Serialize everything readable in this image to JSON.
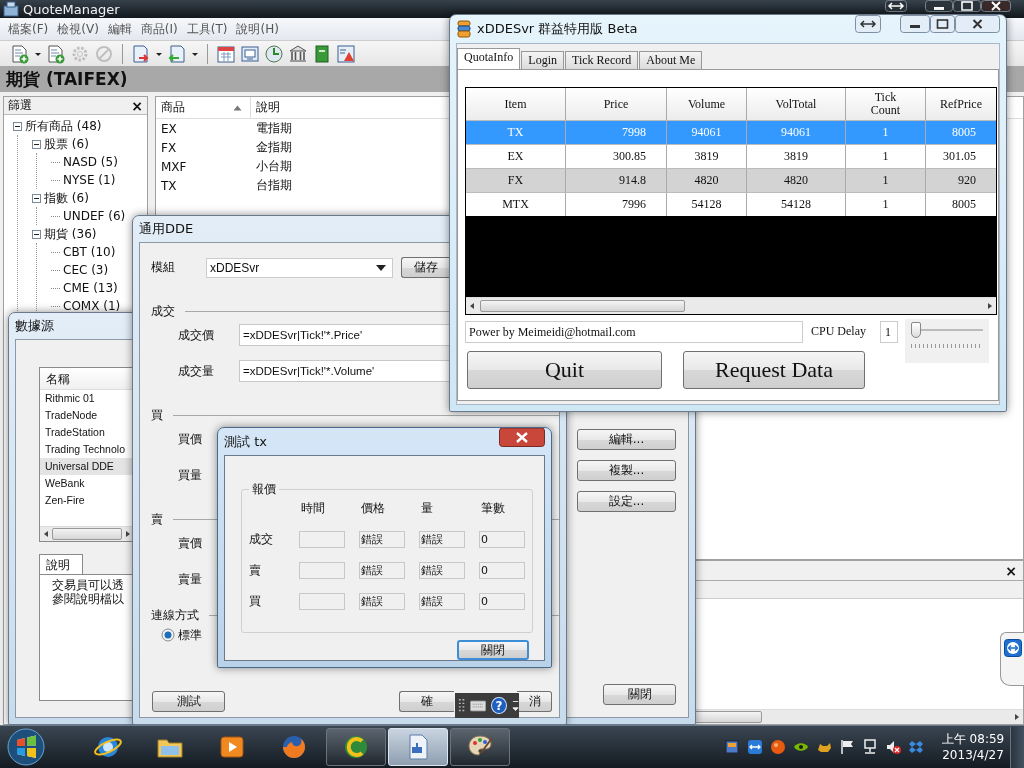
{
  "main_window": {
    "title": "QuoteManager",
    "menu": [
      "檔案(F)",
      "檢視(V)",
      "編輯",
      "商品(I)",
      "工具(T)",
      "說明(H)"
    ],
    "toolbar_groups": [
      [
        {
          "kind": "sheet-add",
          "disabled": false
        },
        {
          "kind": "caret",
          "disabled": false
        },
        {
          "kind": "sheet-add",
          "disabled": false
        },
        {
          "kind": "gear",
          "disabled": true
        },
        {
          "kind": "stop",
          "disabled": true
        }
      ],
      [
        {
          "kind": "export",
          "disabled": false
        },
        {
          "kind": "caret",
          "disabled": false
        },
        {
          "kind": "import",
          "disabled": false
        },
        {
          "kind": "caret",
          "disabled": false
        }
      ],
      [
        {
          "kind": "calendar",
          "disabled": false
        },
        {
          "kind": "monitor",
          "disabled": false
        },
        {
          "kind": "clock",
          "disabled": false
        },
        {
          "kind": "bank",
          "disabled": false
        },
        {
          "kind": "book",
          "disabled": false
        },
        {
          "kind": "chart",
          "disabled": false
        }
      ]
    ],
    "header": "期貨 (TAIFEX)",
    "filter_panel": {
      "title": "篩選",
      "close": "×",
      "tree": [
        {
          "label": "所有商品 (48)",
          "expanded": true,
          "children": [
            {
              "label": "股票 (6)",
              "expanded": true,
              "children": [
                {
                  "label": "NASD (5)"
                },
                {
                  "label": "NYSE (1)"
                }
              ]
            },
            {
              "label": "指數 (6)",
              "expanded": true,
              "children": [
                {
                  "label": "UNDEF (6)"
                }
              ]
            },
            {
              "label": "期貨 (36)",
              "expanded": true,
              "children": [
                {
                  "label": "CBT (10)"
                },
                {
                  "label": "CEC (3)"
                },
                {
                  "label": "CME (13)"
                },
                {
                  "label": "COMX (1)"
                }
              ]
            }
          ]
        }
      ]
    },
    "product_list": {
      "columns": [
        {
          "label": "商品",
          "sorted": true
        },
        {
          "label": "說明",
          "sorted": false
        }
      ],
      "rows": [
        [
          "EX",
          "電指期"
        ],
        [
          "FX",
          "金指期"
        ],
        [
          "MXF",
          "小台期"
        ],
        [
          "TX",
          "台指期"
        ]
      ]
    },
    "output_panel": {
      "close": "×"
    }
  },
  "data_source_window": {
    "title": "數據源",
    "list_column": "名稱",
    "items": [
      {
        "label": "Rithmic 01",
        "selected": false
      },
      {
        "label": "TradeNode",
        "selected": false
      },
      {
        "label": "TradeStation",
        "selected": false
      },
      {
        "label": "Trading Technolo",
        "selected": false
      },
      {
        "label": "Universal DDE",
        "selected": true
      },
      {
        "label": "WeBank",
        "selected": false
      },
      {
        "label": "Zen-Fire",
        "selected": false
      }
    ],
    "description_tab": "說明",
    "description_lines": [
      "交易員可以透",
      "參閱說明檔以"
    ],
    "buttons": [
      "編輯...",
      "複製...",
      "設定..."
    ],
    "close_button": "關閉"
  },
  "dde_window": {
    "title": "通用DDE",
    "module_label": "模組",
    "module_value": "xDDESvr",
    "save_button": "儲存",
    "sections": [
      {
        "title": "成交",
        "fields": [
          {
            "label": "成交價",
            "value": "=xDDESvr|Tick!'*.Price'"
          },
          {
            "label": "成交量",
            "value": "=xDDESvr|Tick!'*.Volume'"
          }
        ]
      },
      {
        "title": "買",
        "fields": [
          {
            "label": "買價"
          },
          {
            "label": "買量"
          }
        ]
      },
      {
        "title": "賣",
        "fields": [
          {
            "label": "賣價"
          },
          {
            "label": "賣量"
          }
        ]
      }
    ],
    "connection": {
      "title": "連線方式",
      "options": [
        {
          "label": "標準",
          "selected": true
        }
      ]
    },
    "test_button": "測試",
    "ok_button": "確",
    "cancel_button": "消"
  },
  "test_dialog": {
    "title": "測試 tx",
    "group": "報價",
    "columns": [
      "時間",
      "價格",
      "量",
      "筆數"
    ],
    "rows": [
      {
        "label": "成交",
        "values": [
          "錯誤",
          "錯誤",
          "0"
        ]
      },
      {
        "label": "賣",
        "values": [
          "錯誤",
          "錯誤",
          "0"
        ]
      },
      {
        "label": "買",
        "values": [
          "錯誤",
          "錯誤",
          "0"
        ]
      }
    ],
    "close_button": "關閉"
  },
  "xddesvr_window": {
    "title": "xDDESvr 群益特用版 Beta",
    "tabs": [
      {
        "label": "QuotaInfo",
        "selected": true
      },
      {
        "label": "Login",
        "selected": false
      },
      {
        "label": "Tick Record",
        "selected": false
      },
      {
        "label": "About Me",
        "selected": false
      }
    ],
    "columns": [
      "Item",
      "Price",
      "Volume",
      "VolTotal",
      "Tick Count",
      "RefPrice"
    ],
    "rows": [
      {
        "cells": [
          "TX",
          "7998",
          "94061",
          "94061",
          "1",
          "8005"
        ],
        "selected": true
      },
      {
        "cells": [
          "EX",
          "300.85",
          "3819",
          "3819",
          "1",
          "301.05"
        ],
        "selected": false
      },
      {
        "cells": [
          "FX",
          "914.8",
          "4820",
          "4820",
          "1",
          "920"
        ],
        "selected": false
      },
      {
        "cells": [
          "MTX",
          "7996",
          "54128",
          "54128",
          "1",
          "8005"
        ],
        "selected": false
      }
    ],
    "status": "Power by Meimeidi@hotmail.com",
    "cpu_label": "CPU Delay",
    "cpu_value": "1",
    "cpu_slider": {
      "level": 0
    },
    "quit_button": "Quit",
    "request_button": "Request Data"
  },
  "language_bar": {
    "help": "?"
  },
  "taskbar": {
    "apps": [
      {
        "kind": "ie",
        "running": false,
        "active": false
      },
      {
        "kind": "explorer",
        "running": false,
        "active": false
      },
      {
        "kind": "media",
        "running": false,
        "active": false
      },
      {
        "kind": "firefox",
        "running": false,
        "active": false
      },
      {
        "kind": "swirl",
        "running": true,
        "active": false
      },
      {
        "kind": "document",
        "running": true,
        "active": true
      },
      {
        "kind": "paint",
        "running": true,
        "active": false
      }
    ],
    "tray": [
      {
        "kind": "cube"
      },
      {
        "kind": "remote"
      },
      {
        "kind": "ball"
      },
      {
        "kind": "eye"
      },
      {
        "kind": "animal"
      },
      {
        "kind": "flag"
      },
      {
        "kind": "network"
      },
      {
        "kind": "mute"
      },
      {
        "kind": "box"
      }
    ],
    "time": "上午 08:59",
    "date": "2013/4/27"
  }
}
